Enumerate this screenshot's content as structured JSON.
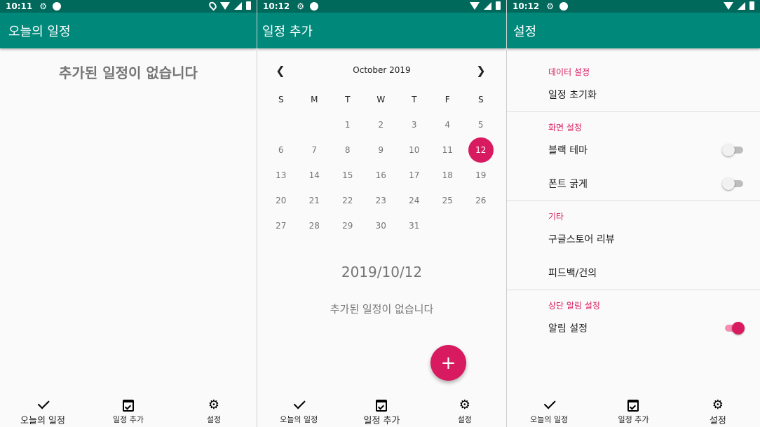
{
  "status": {
    "screen1_time": "10:11",
    "screen2_time": "10:12",
    "screen3_time": "10:12"
  },
  "screen1": {
    "title": "오늘의 일정",
    "empty_message": "추가된 일정이 없습니다"
  },
  "screen2": {
    "title": "일정 추가",
    "calendar": {
      "month_label": "October 2019",
      "days_of_week": [
        "S",
        "M",
        "T",
        "W",
        "T",
        "F",
        "S"
      ],
      "weeks": [
        [
          "",
          "",
          "1",
          "2",
          "3",
          "4",
          "5"
        ],
        [
          "6",
          "7",
          "8",
          "9",
          "10",
          "11",
          "12"
        ],
        [
          "13",
          "14",
          "15",
          "16",
          "17",
          "18",
          "19"
        ],
        [
          "20",
          "21",
          "22",
          "23",
          "24",
          "25",
          "26"
        ],
        [
          "27",
          "28",
          "29",
          "30",
          "31",
          "",
          ""
        ]
      ],
      "selected_day": "12"
    },
    "selected_date": "2019/10/12",
    "empty_message": "추가된 일정이 없습니다",
    "fab_icon": "+"
  },
  "screen3": {
    "title": "설정",
    "sections": [
      {
        "category": "데이터 설정",
        "items": [
          {
            "label": "일정 초기화",
            "switch": null
          }
        ]
      },
      {
        "category": "화면 설정",
        "items": [
          {
            "label": "블랙 테마",
            "switch": false
          },
          {
            "label": "폰트 굵게",
            "switch": false
          }
        ]
      },
      {
        "category": "기타",
        "items": [
          {
            "label": "구글스토어 리뷰",
            "switch": null
          },
          {
            "label": "피드백/건의",
            "switch": null
          }
        ]
      },
      {
        "category": "상단 알림 설정",
        "items": [
          {
            "label": "알림 설정",
            "switch": true
          }
        ]
      }
    ]
  },
  "nav": {
    "today": "오늘의 일정",
    "add": "일정 추가",
    "settings": "설정"
  },
  "colors": {
    "status_bar": "#00695c",
    "app_bar": "#00897b",
    "accent": "#d81b60"
  }
}
